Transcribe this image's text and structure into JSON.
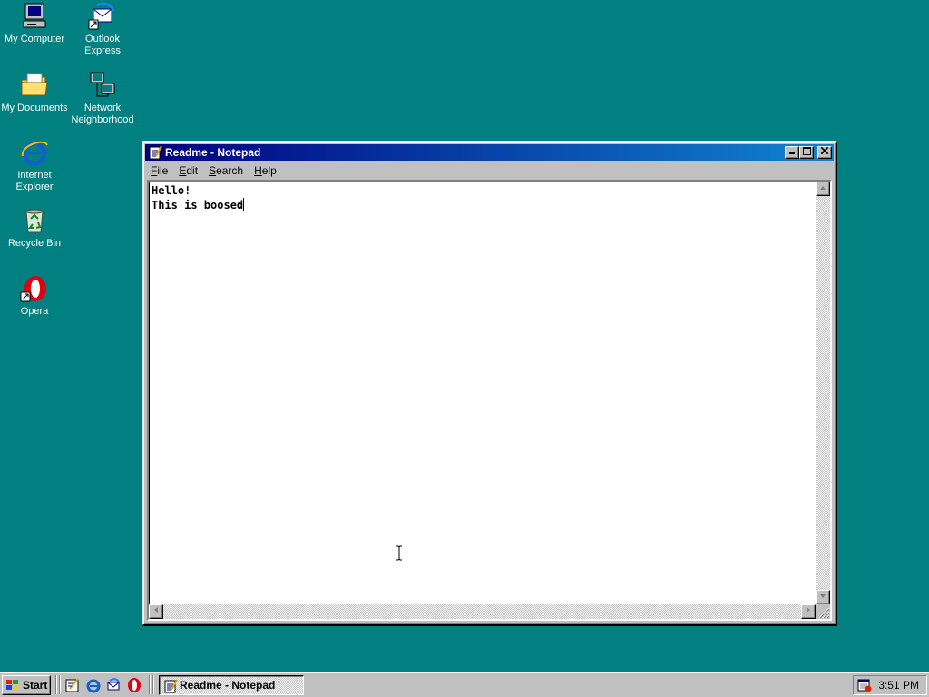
{
  "desktop": {
    "icons": [
      {
        "label": "My Computer",
        "icon": "computer-icon"
      },
      {
        "label": "Outlook Express",
        "icon": "outlook-icon"
      },
      {
        "label": "My Documents",
        "icon": "folder-icon"
      },
      {
        "label": "Network Neighborhood",
        "icon": "network-icon"
      },
      {
        "label": "Internet Explorer",
        "icon": "ie-icon"
      },
      {
        "label": "Recycle Bin",
        "icon": "recycle-bin-icon"
      },
      {
        "label": "Opera",
        "icon": "opera-icon"
      }
    ]
  },
  "window": {
    "title": "Readme - Notepad",
    "menu": {
      "file": {
        "accel": "F",
        "rest": "ile"
      },
      "edit": {
        "accel": "E",
        "rest": "dit"
      },
      "search": {
        "accel": "S",
        "rest": "earch"
      },
      "help": {
        "accel": "H",
        "rest": "elp"
      }
    },
    "content": {
      "line1": "Hello!",
      "line2": "This is boosed"
    }
  },
  "taskbar": {
    "start_label": "Start",
    "task_label": "Readme - Notepad",
    "clock": "3:51 PM"
  },
  "colors": {
    "desktop": "#008080",
    "titlebar": "#000080",
    "face": "#c0c0c0"
  }
}
